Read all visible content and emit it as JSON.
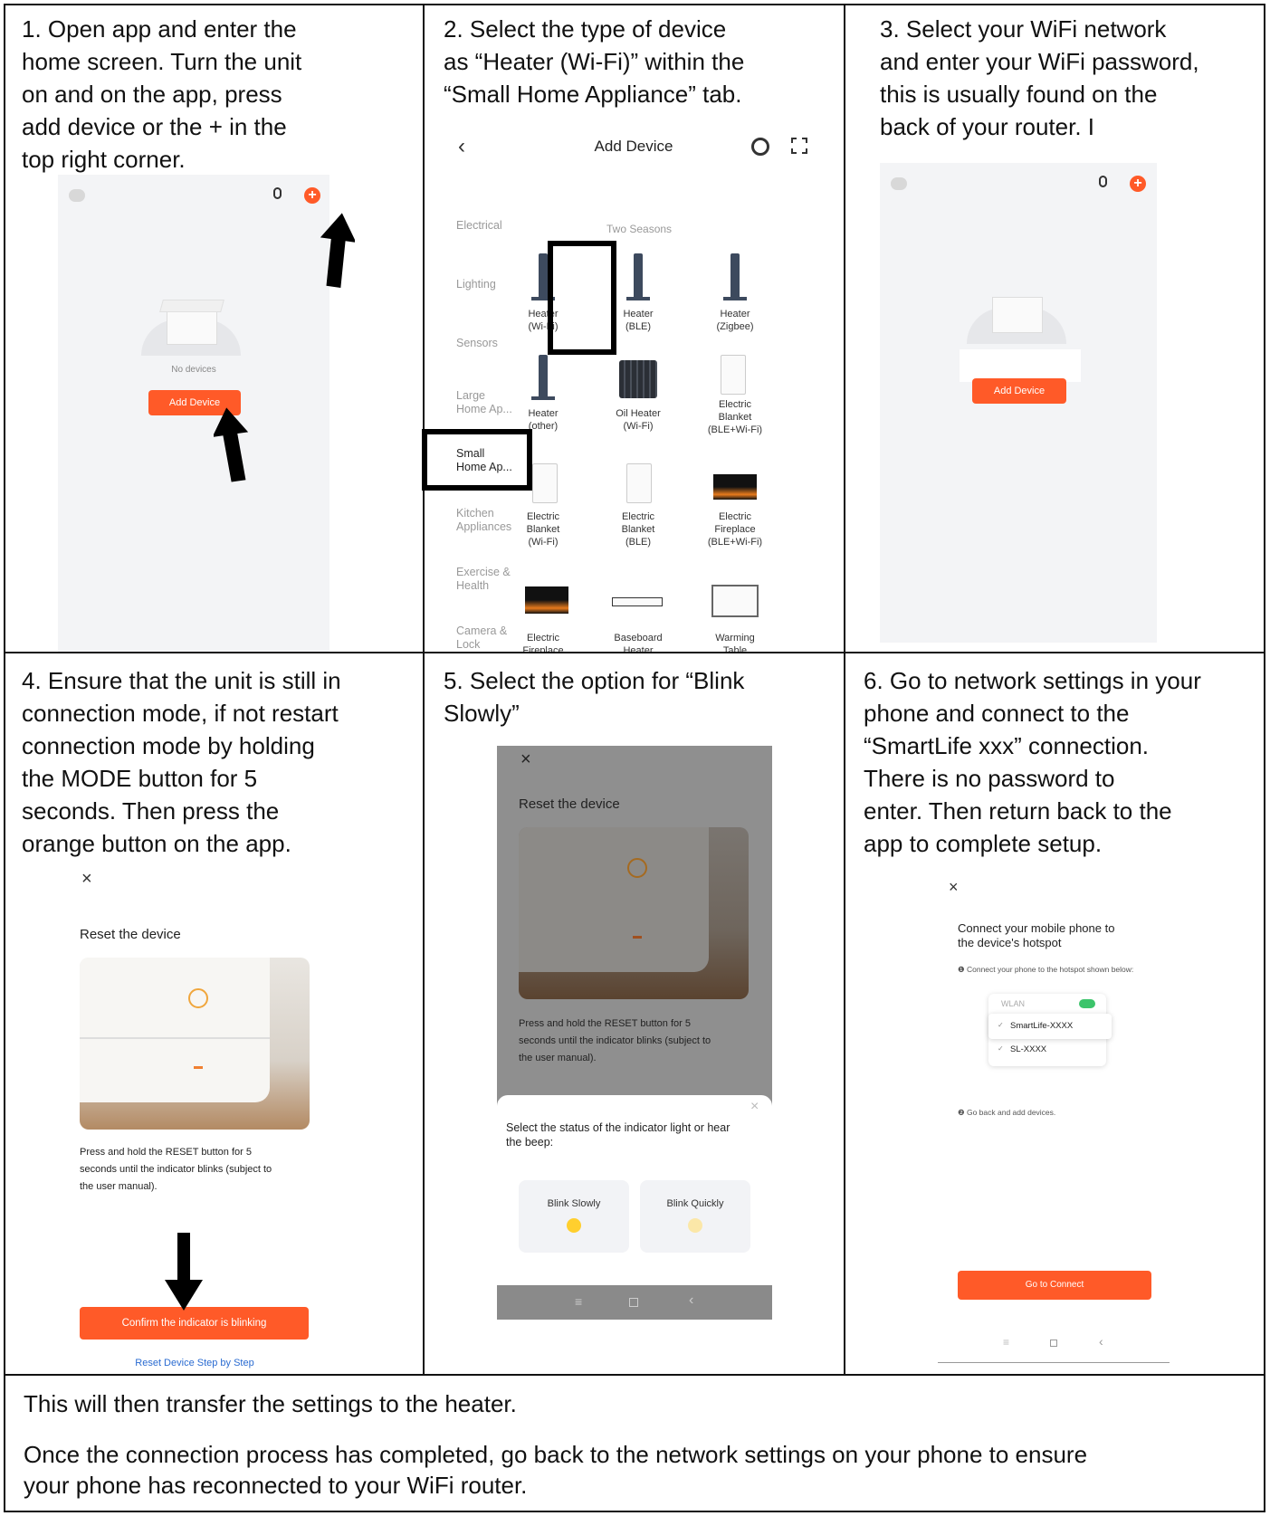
{
  "steps": {
    "s1": "1.  Open app and enter the\n       home screen. Turn the unit\n       on and on the app, press\n       add device or the + in the\n       top right corner.",
    "s2": "2.  Select the type of device\n       as “Heater (Wi-Fi)” within the\n       “Small Home Appliance” tab.",
    "s3": "3. Select your WiFi network\nand enter your WiFi password,\nthis is usually found on the\nback of your router. I",
    "s4": "4. Ensure that the unit is still in\n     connection mode, if not restart\n     connection mode by holding\n     the MODE button for 5\n     seconds. Then press the\n     orange button on the app.",
    "s5": "5. Select the option  for “Blink\n     Slowly”",
    "s6": "6. Go to network settings in your\n     phone and connect to the\n     “SmartLife xxx” connection.\n     There is no password to\n     enter. Then return back to the\n     app to complete setup."
  },
  "screen1": {
    "no_devices": "No devices",
    "add_device": "Add Device"
  },
  "screen2": {
    "title": "Add Device",
    "brand": "Two Seasons",
    "categories": [
      "Electrical",
      "Lighting",
      "Sensors",
      "Large\nHome Ap...",
      "Small\nHome Ap...",
      "Kitchen\nAppliances",
      "Exercise &\nHealth",
      "Camera &\nLock"
    ],
    "devices": [
      "Heater\n(Wi-Fi)",
      "Heater\n(BLE)",
      "Heater\n(Zigbee)",
      "Heater\n(other)",
      "Oil Heater\n(Wi-Fi)",
      "Electric\nBlanket\n(BLE+Wi-Fi)",
      "Electric\nBlanket\n(Wi-Fi)",
      "Electric\nBlanket\n(BLE)",
      "Electric\nFireplace\n(BLE+Wi-Fi)",
      "Electric\nFireplace",
      "Baseboard\nHeater",
      "Warming\nTable"
    ]
  },
  "screen3": {
    "add_device": "Add Device"
  },
  "screen4": {
    "close": "×",
    "title": "Reset the device",
    "body": "Press and hold the RESET button for 5\nseconds until the indicator blinks (subject to\nthe user manual).",
    "confirm": "Confirm the indicator is blinking",
    "link": "Reset Device Step by Step"
  },
  "screen5": {
    "close": "×",
    "title": "Reset the device",
    "body": "Press and hold the RESET button for 5\nseconds until the indicator blinks (subject to\nthe user manual).",
    "sheet_close": "×",
    "sheet_title": "Select the status of the indicator light or hear\nthe beep:",
    "opt1": "Blink Slowly",
    "opt2": "Blink Quickly"
  },
  "screen6": {
    "close": "×",
    "title": "Connect your mobile phone to\nthe device's hotspot",
    "hint": "❶ Connect your phone to the hotspot shown below:",
    "wlan": "WLAN",
    "net1": "SmartLife-XXXX",
    "net2": "SL-XXXX",
    "hint2": "❷ Go back and add devices.",
    "button": "Go to Connect"
  },
  "footer": {
    "line1": "This will then transfer the settings to the heater.",
    "line2": "Once the connection process has completed, go back to the network settings on your phone to ensure\nyour phone has reconnected to your WiFi router."
  },
  "colors": {
    "accent": "#ff5a28",
    "border": "#111111"
  }
}
